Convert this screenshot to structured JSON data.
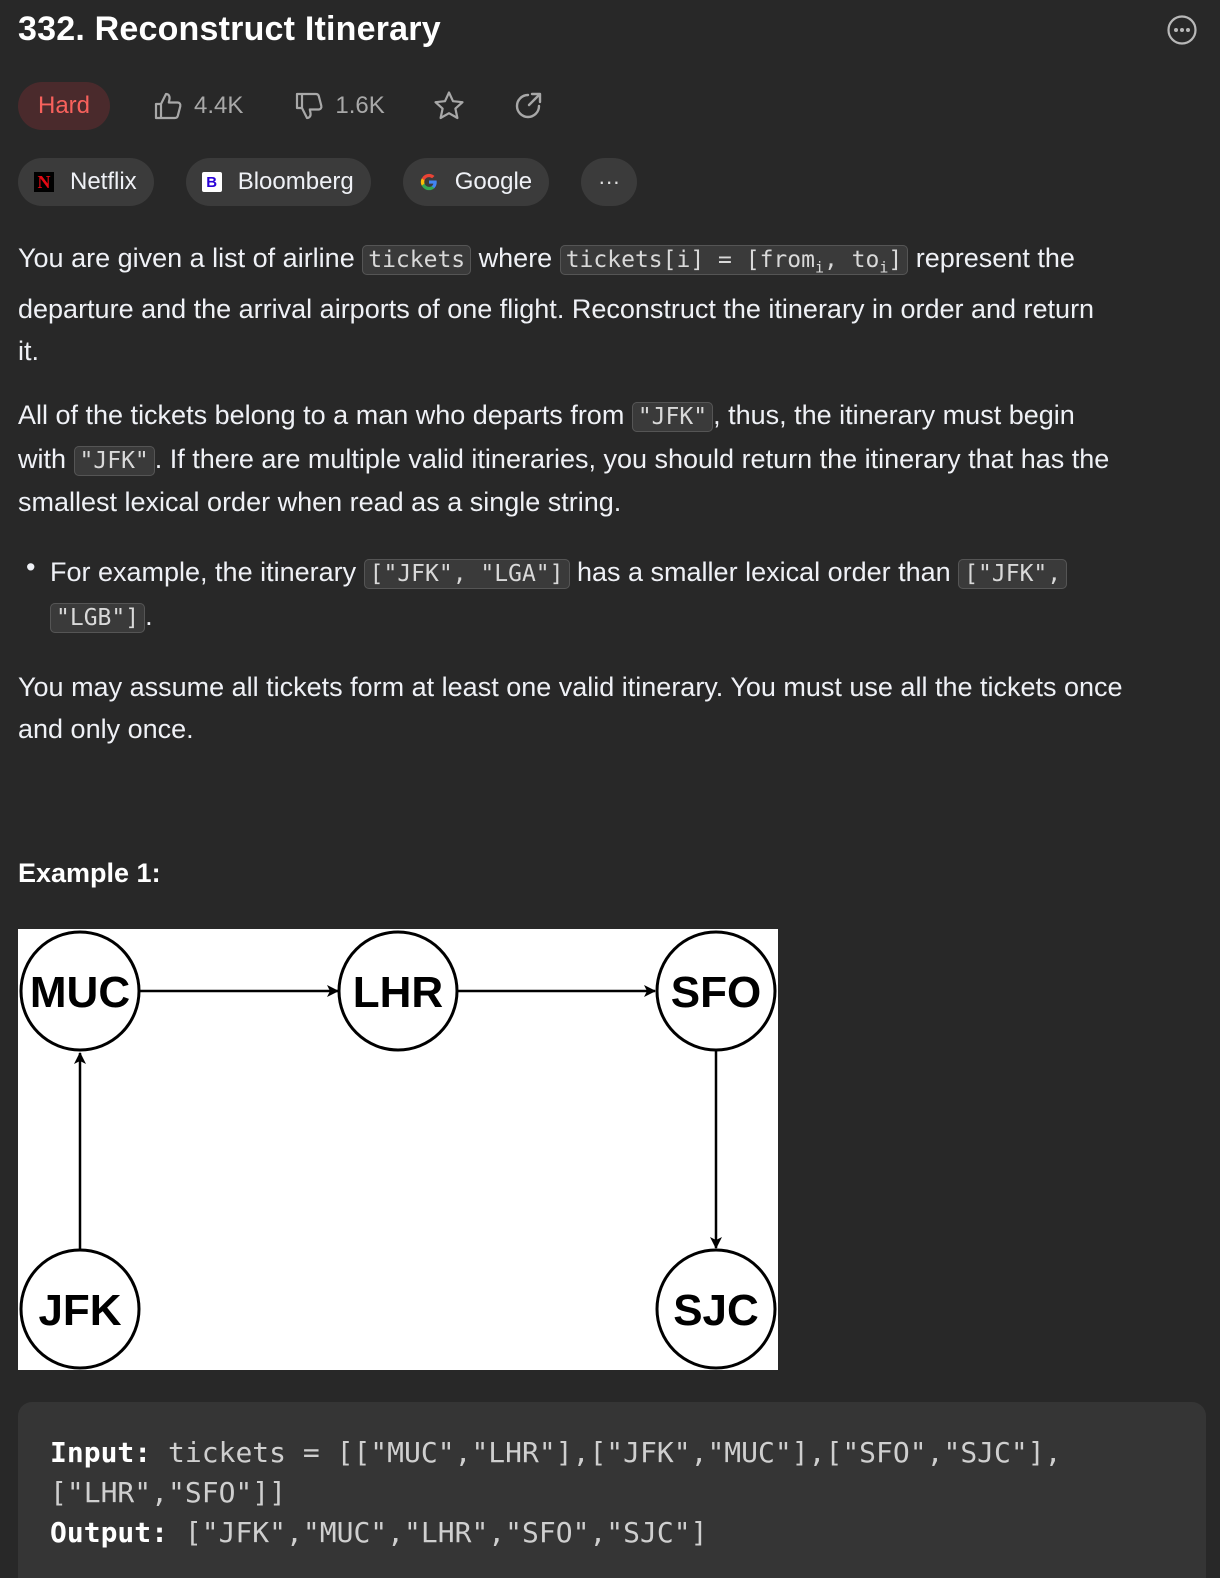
{
  "problem": {
    "title": "332. Reconstruct Itinerary",
    "difficulty": "Hard",
    "likes": "4.4K",
    "dislikes": "1.6K"
  },
  "companies": [
    {
      "name": "Netflix",
      "logo_letter": "N",
      "logo_color": "#e50914"
    },
    {
      "name": "Bloomberg",
      "logo_letter": "B",
      "logo_color": "#2800d7"
    },
    {
      "name": "Google",
      "logo_letter": "G",
      "logo_color": "#4285f4"
    }
  ],
  "colors": {
    "background": "#282828",
    "hard": "#f8615c",
    "hard_bg": "#4a2a2c",
    "chip_bg": "#3b3b3b",
    "text": "#eff1f6",
    "muted": "#a8a8a8"
  },
  "description": {
    "p1": {
      "t1": "You are given a list of airline ",
      "c1": "tickets",
      "t2": " where ",
      "c2_pre": "tickets[i] = [from",
      "c2_sub1": "i",
      "c2_mid": ", to",
      "c2_sub2": "i",
      "c2_post": "]",
      "t3": " represent the",
      "line2": "departure and the arrival airports of one flight. Reconstruct the itinerary in order and return",
      "line3": "it."
    },
    "p2": {
      "t1": "All of the tickets belong to a man who departs from ",
      "c1": "\"JFK\"",
      "t2": ", thus, the itinerary must begin",
      "t3": "with ",
      "c2": "\"JFK\"",
      "t4": ". If there are multiple valid itineraries, you should return the itinerary that has the",
      "line3": "smallest lexical order when read as a single string."
    },
    "bullet": {
      "t1": "For example, the itinerary ",
      "c1": "[\"JFK\", \"LGA\"]",
      "t2": " has a smaller lexical order than ",
      "c2a": "[\"JFK\",",
      "c2b": "\"LGB\"]",
      "t3": "."
    },
    "p3": {
      "line1": "You may assume all tickets form at least one valid itinerary. You must use all the tickets once",
      "line2": "and only once."
    }
  },
  "example": {
    "heading": "Example 1:",
    "diagram_nodes": [
      "MUC",
      "LHR",
      "SFO",
      "JFK",
      "SJC"
    ],
    "input_label": "Input:",
    "input_line1": "tickets = [[\"MUC\",\"LHR\"],[\"JFK\",\"MUC\"],[\"SFO\",\"SJC\"],",
    "input_line2": "[\"LHR\",\"SFO\"]]",
    "output_label": "Output:",
    "output_value": "[\"JFK\",\"MUC\",\"LHR\",\"SFO\",\"SJC\"]"
  },
  "icons": [
    "thumbs-up-icon",
    "thumbs-down-icon",
    "star-icon",
    "share-icon",
    "more-options-icon",
    "ellipsis-icon"
  ]
}
